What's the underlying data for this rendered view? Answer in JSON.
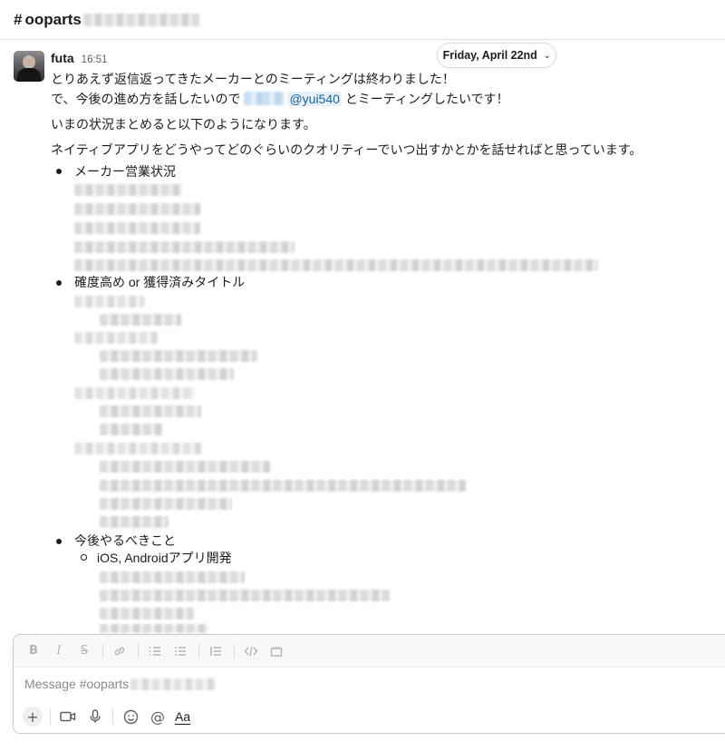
{
  "channel": {
    "hash": "#",
    "name": "ooparts"
  },
  "date_divider": {
    "label": "Friday, April 22nd",
    "chevron": "⌄"
  },
  "message": {
    "author": "futa",
    "time": "16:51",
    "lines": [
      "とりあえず返信返ってきたメーカーとのミーティングは終わりました！",
      "で、今後の進め方を話したいので",
      "いまの状況まとめると以下のようになります。",
      "ネイティブアプリをどうやってどのぐらいのクオリティーでいつ出すかとかを話せればと思っています。"
    ],
    "mention": "@yui540",
    "line2_suffix": "とミーティングしたいです！",
    "bullets": [
      "メーカー営業状況",
      "確度高め or 獲得済みタイトル",
      "今後やるべきこと"
    ],
    "sub_bullet": "iOS, Androidアプリ開発"
  },
  "composer": {
    "placeholder": "Message #ooparts",
    "toolbar_icons": [
      "bold-icon",
      "italic-icon",
      "strikethrough-icon",
      "link-icon",
      "ordered-list-icon",
      "bulleted-list-icon",
      "blockquote-icon",
      "code-icon",
      "code-block-icon"
    ],
    "toolbar_glyphs": {
      "bold": "B",
      "italic": "I",
      "strike": "S",
      "link": "🔗",
      "ordered": "≡",
      "bulleted": "☰",
      "quote": "❘≡",
      "code": "</>",
      "codeblock": "⎆"
    },
    "action_glyphs": {
      "plus": "+",
      "emoji": "☺",
      "mention": "@",
      "format": "Aa"
    }
  },
  "colors": {
    "text": "#1d1c1d",
    "muted": "#616061",
    "mention": "#1264a3",
    "mention_bg": "#e8f1f9",
    "border": "#c8c8c8"
  }
}
